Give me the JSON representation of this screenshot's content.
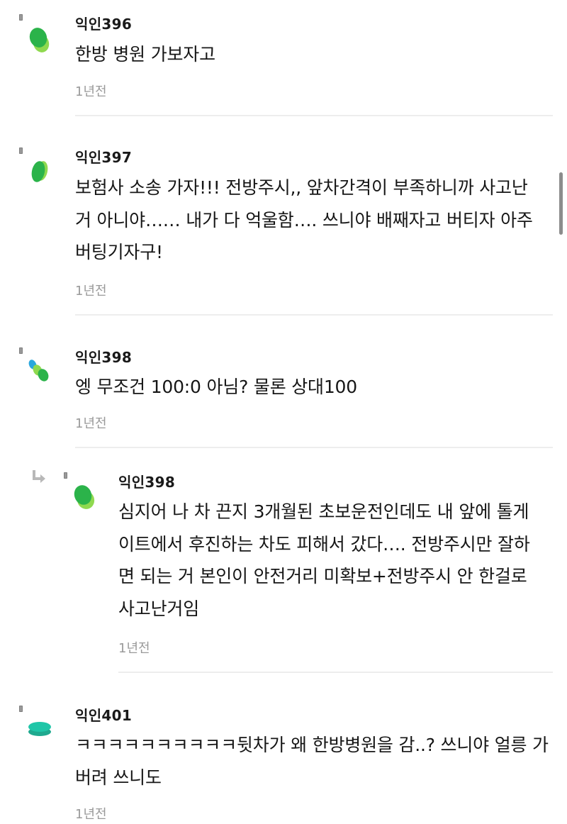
{
  "comments": [
    {
      "author": "익인396",
      "text": "한방 병원 가보자고",
      "time": "1년전"
    },
    {
      "author": "익인397",
      "text": "보험사 소송 가자!!! 전방주시,, 앞차간격이 부족하니까 사고난\n거 아니야…… 내가 다 억울함…. 쓰니야 배째자고 버티자 아주\n버팅기자구!",
      "time": "1년전"
    },
    {
      "author": "익인398",
      "text": "엥 무조건 100:0 아님? 물론 상대100",
      "time": "1년전"
    },
    {
      "author": "익인398",
      "text": "심지어 나 차 끈지 3개월된 초보운전인데도 내 앞에 톨게\n이트에서 후진하는 차도 피해서 갔다…. 전방주시만 잘하\n면 되는 거 본인이 안전거리 미확보+전방주시 안 한걸로\n사고난거임",
      "time": "1년전",
      "is_reply": true
    },
    {
      "author": "익인401",
      "text": "ㅋㅋㅋㅋㅋㅋㅋㅋㅋㅋ뒷차가 왜 한방병원을 감..? 쓰니야 얼릉 가\n버려 쓰니도",
      "time": "1년전"
    }
  ],
  "colors": {
    "avatar_green": "#2bb34a",
    "avatar_light_green": "#8fd94f",
    "avatar_teal": "#1fc6a8",
    "avatar_blue": "#2aa7de",
    "divider": "#ededed",
    "meta_text": "#9a9a9a"
  },
  "icons": {
    "reply": "reply-arrow-icon",
    "avatar": "leaf-avatar-icon"
  }
}
